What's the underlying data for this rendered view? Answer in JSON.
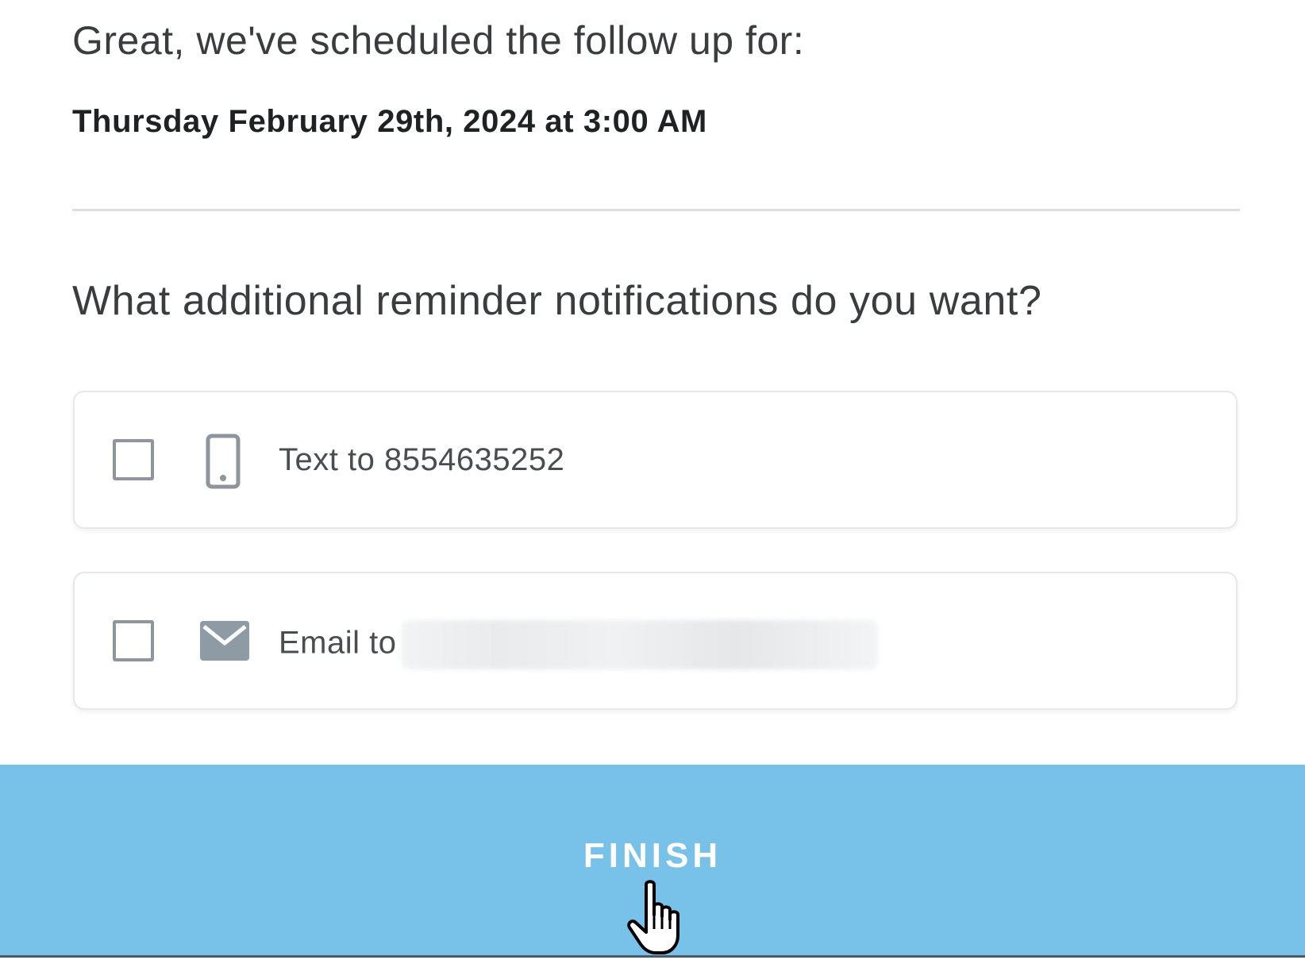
{
  "confirmation": {
    "heading": "Great, we've scheduled the follow up for:",
    "scheduled_datetime": "Thursday February 29th, 2024 at 3:00 AM"
  },
  "reminders": {
    "question": "What additional reminder notifications do you want?",
    "options": [
      {
        "label": "Text to 8554635252",
        "icon": "mobile-phone-icon",
        "checked": false
      },
      {
        "label": "Email to",
        "icon": "envelope-icon",
        "checked": false
      }
    ]
  },
  "footer": {
    "finish_label": "FINISH",
    "color": "#78c1e9"
  },
  "cursor": {
    "icon": "hand-pointer-icon"
  }
}
